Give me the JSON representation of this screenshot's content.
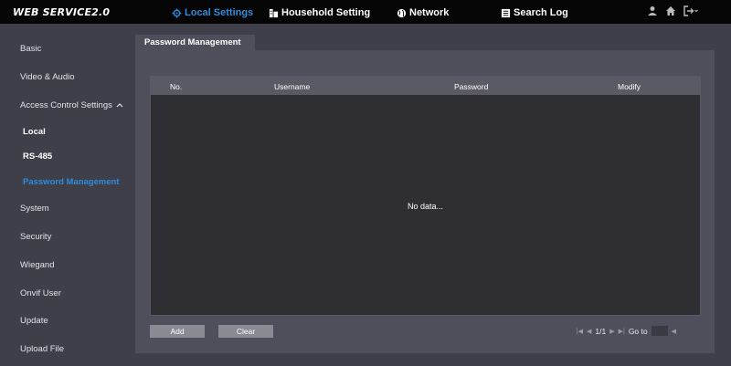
{
  "brand": "WEB SERVICE2.0",
  "nav": [
    {
      "label": "Local Settings",
      "icon": "gear-icon"
    },
    {
      "label": "Household Setting",
      "icon": "building-icon"
    },
    {
      "label": "Network",
      "icon": "globe-icon"
    },
    {
      "label": "Search Log",
      "icon": "log-icon"
    }
  ],
  "sidebar": {
    "items": [
      "Basic",
      "Video & Audio",
      "Access Control Settings"
    ],
    "sub_items": [
      "Local",
      "RS-485",
      "Password Management"
    ],
    "more_items": [
      "System",
      "Security",
      "Wiegand",
      "Onvif User",
      "Update",
      "Upload File"
    ]
  },
  "tab": "Password Management",
  "table": {
    "columns": [
      "No.",
      "Username",
      "Password",
      "Modify"
    ],
    "empty_text": "No data..."
  },
  "buttons": {
    "add": "Add",
    "clear": "Clear"
  },
  "pager": {
    "page": "1/1",
    "goto": "Go to"
  },
  "colors": {
    "accent": "#2f8bdc",
    "topbar": "#050505",
    "panel": "#4f4f5b"
  }
}
